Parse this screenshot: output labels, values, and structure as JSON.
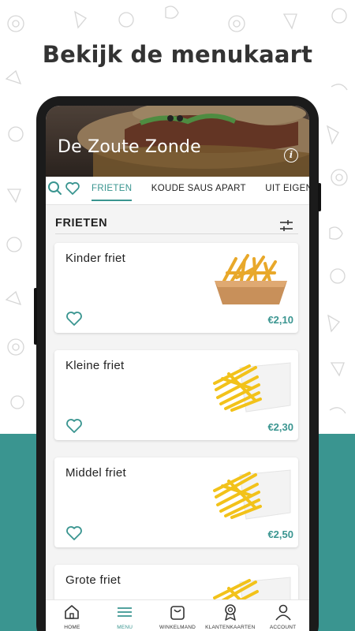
{
  "headline": "Bekijk de menukaart",
  "colors": {
    "accent": "#3a9590",
    "text": "#222222"
  },
  "restaurant": {
    "name": "De Zoute Zonde",
    "info_icon": "info-icon"
  },
  "categories": {
    "search_icon": "search-icon",
    "favorites_icon": "heart-icon",
    "tabs": [
      {
        "label": "FRIETEN",
        "active": true
      },
      {
        "label": "KOUDE SAUS APART",
        "active": false
      },
      {
        "label": "UIT EIGEN KEUKEN",
        "active": false
      }
    ]
  },
  "section": {
    "title": "FRIETEN",
    "filter_icon": "sliders-icon"
  },
  "products": [
    {
      "name": "Kinder friet",
      "price": "€2,10",
      "image": "fries-tray"
    },
    {
      "name": "Kleine friet",
      "price": "€2,30",
      "image": "fries-bag"
    },
    {
      "name": "Middel friet",
      "price": "€2,50",
      "image": "fries-bag"
    },
    {
      "name": "Grote friet",
      "price": "",
      "image": "fries-bag"
    }
  ],
  "bottom_nav": [
    {
      "label": "HOME",
      "icon": "home-icon",
      "active": false
    },
    {
      "label": "MENU",
      "icon": "menu-icon",
      "active": true
    },
    {
      "label": "WINKELMAND",
      "icon": "basket-icon",
      "active": false
    },
    {
      "label": "KLANTENKAARTEN",
      "icon": "award-icon",
      "active": false
    },
    {
      "label": "ACCOUNT",
      "icon": "user-icon",
      "active": false
    }
  ]
}
